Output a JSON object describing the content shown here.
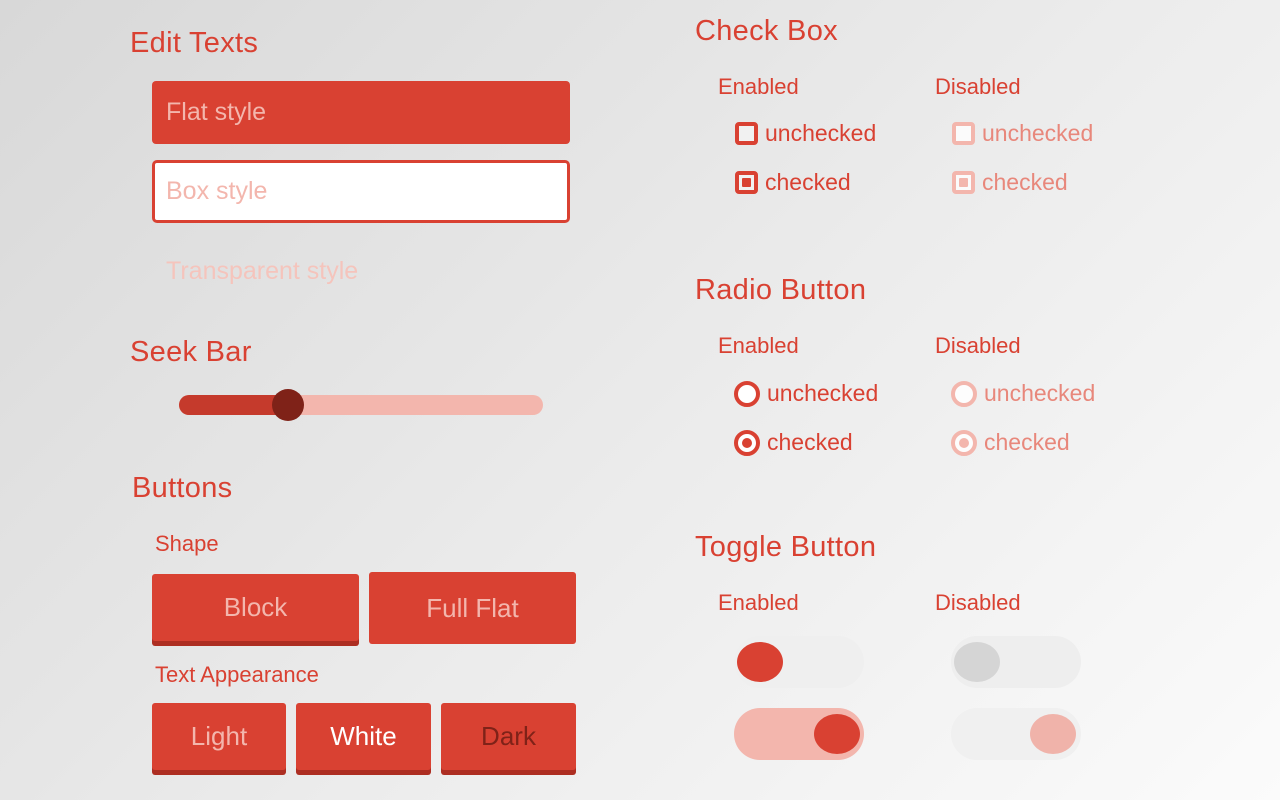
{
  "edit_texts": {
    "title": "Edit Texts",
    "flat_placeholder": "Flat style",
    "box_placeholder": "Box style",
    "transparent_placeholder": "Transparent style"
  },
  "seek_bar": {
    "title": "Seek Bar",
    "value_fraction": 0.3
  },
  "buttons": {
    "title": "Buttons",
    "shape_label": "Shape",
    "block_label": "Block",
    "full_flat_label": "Full Flat",
    "text_appearance_label": "Text Appearance",
    "light_label": "Light",
    "white_label": "White",
    "dark_label": "Dark"
  },
  "check_box": {
    "title": "Check Box",
    "enabled_label": "Enabled",
    "disabled_label": "Disabled",
    "unchecked_label": "unchecked",
    "checked_label": "checked"
  },
  "radio_button": {
    "title": "Radio Button",
    "enabled_label": "Enabled",
    "disabled_label": "Disabled",
    "unchecked_label": "unchecked",
    "checked_label": "checked"
  },
  "toggle_button": {
    "title": "Toggle Button",
    "enabled_label": "Enabled",
    "disabled_label": "Disabled"
  },
  "colors": {
    "accent": "#d94132",
    "accent_light": "#f3b6ad",
    "accent_dark": "#7f2218"
  }
}
